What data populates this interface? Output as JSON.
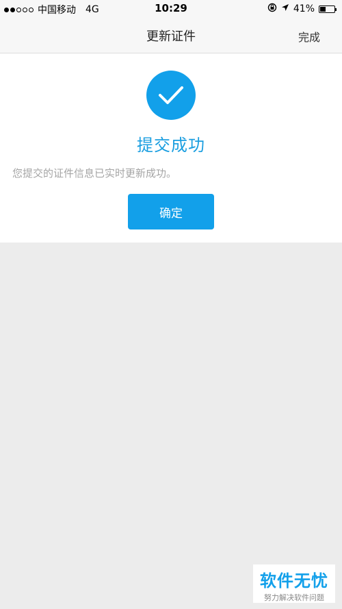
{
  "status_bar": {
    "carrier": "中国移动",
    "network": "4G",
    "time": "10:29",
    "battery": "41%",
    "battery_level": 0.41,
    "signal_filled": 2,
    "signal_total": 5
  },
  "nav": {
    "title": "更新证件",
    "done_label": "完成"
  },
  "result": {
    "icon": "check-icon",
    "title": "提交成功",
    "description": "您提交的证件信息已实时更新成功。",
    "confirm_label": "确定"
  },
  "watermark": {
    "main": "软件无忧",
    "sub": "努力解决软件问题"
  },
  "colors": {
    "accent": "#12a0ea",
    "page_bg": "#ececec",
    "nav_bg": "#f7f7f7",
    "desc_text": "#a5a5a5"
  }
}
